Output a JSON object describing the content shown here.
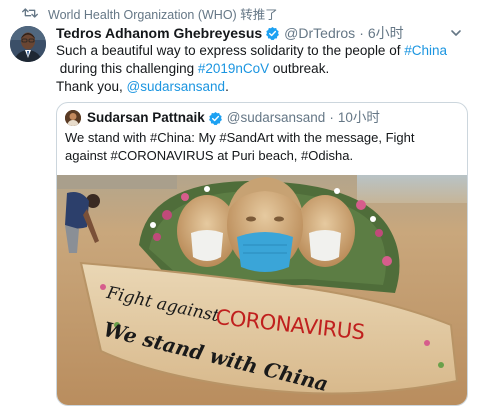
{
  "retweet": {
    "icon": "retweet-icon",
    "text": "World Health Organization (WHO) 转推了"
  },
  "tweet": {
    "author_name": "Tedros Adhanom Ghebreyesus",
    "verified_icon": "verified-badge-icon",
    "handle": "@DrTedros",
    "dot": "·",
    "time": "6小时",
    "text_parts": {
      "line1_a": "Such a beautiful way to express solidarity to the people of ",
      "line1_hashtag": "#China",
      "line2_a": " during this challenging ",
      "line2_hashtag": "#2019nCoV",
      "line2_b": " outbreak.",
      "line3_a": "Thank you, ",
      "line3_mention": "@sudarsansand",
      "line3_b": "."
    }
  },
  "quote": {
    "author_name": "Sudarsan Pattnaik",
    "handle": "@sudarsansand",
    "dot": "·",
    "time": "10小时",
    "text_line1": "We stand with #China: My #SandArt with the message, Fight",
    "text_line2": "against #CORONAVIRUS at Puri beach, #Odisha.",
    "image_caption_top": "Fight against",
    "image_caption_virus": "CORONAVIRUS",
    "image_caption_bottom": "We stand with China"
  },
  "colors": {
    "link": "#1b95e0",
    "secondary_text": "#657786",
    "border": "#ccd6dd",
    "mask_blue": "#3aa5d8",
    "sand": "#c9a77c",
    "caption_red": "#c0201e"
  }
}
